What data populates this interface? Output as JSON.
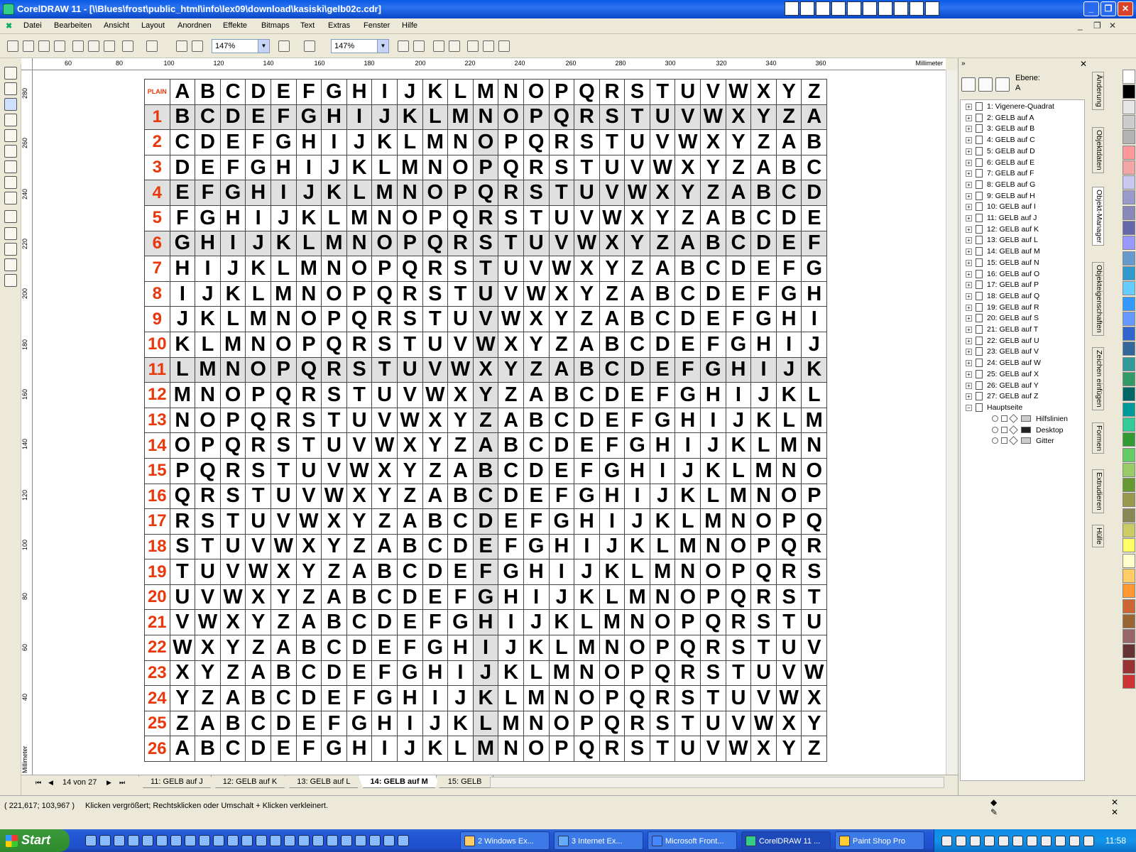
{
  "window": {
    "title": "CorelDRAW 11 - [\\\\Blues\\frost\\public_html\\info\\lex09\\download\\kasiski\\gelb02c.cdr]"
  },
  "menu": [
    "Datei",
    "Bearbeiten",
    "Ansicht",
    "Layout",
    "Anordnen",
    "Effekte",
    "Bitmaps",
    "Text",
    "Extras",
    "Fenster",
    "Hilfe"
  ],
  "toolbar": {
    "zoom1": "147%",
    "zoom2": "147%"
  },
  "ruler": {
    "unit": "Millimeter",
    "h_labels": [
      "60",
      "80",
      "100",
      "120",
      "140",
      "160",
      "180",
      "200",
      "220",
      "240",
      "260",
      "280",
      "300",
      "320",
      "340",
      "360"
    ],
    "v_labels": [
      "280",
      "260",
      "240",
      "220",
      "200",
      "180",
      "160",
      "140",
      "120",
      "100",
      "80",
      "60",
      "40"
    ]
  },
  "table": {
    "plain_label": "PLAIN",
    "alphabet": "ABCDEFGHIJKLMNOPQRSTUVWXYZ",
    "row_count": 26,
    "shaded_rows": [
      1,
      4,
      6,
      11
    ],
    "shaded_column": "M",
    "highlighted_rows": [
      1,
      4,
      6,
      11
    ]
  },
  "pagenav": {
    "counter": "14 von 27",
    "tabs": [
      "11: GELB auf J",
      "12: GELB auf K",
      "13: GELB auf L",
      "14: GELB auf M",
      "15: GELB"
    ],
    "active": "14: GELB auf M"
  },
  "docker": {
    "ebene_label": "Ebene:",
    "ebene_value": "A",
    "items": [
      "1: Vigenere-Quadrat",
      "2: GELB auf A",
      "3: GELB auf B",
      "4: GELB auf C",
      "5: GELB auf D",
      "6: GELB auf E",
      "7: GELB auf F",
      "8: GELB auf G",
      "9: GELB auf H",
      "10: GELB auf I",
      "11: GELB auf J",
      "12: GELB auf K",
      "13: GELB auf L",
      "14: GELB auf M",
      "15: GELB auf N",
      "16: GELB auf O",
      "17: GELB auf P",
      "18: GELB auf Q",
      "19: GELB auf R",
      "20: GELB auf S",
      "21: GELB auf T",
      "22: GELB auf U",
      "23: GELB auf V",
      "24: GELB auf W",
      "25: GELB auf X",
      "26: GELB auf Y",
      "27: GELB auf Z"
    ],
    "master": "Hauptseite",
    "master_layers": [
      "Hilfslinien",
      "Desktop",
      "Gitter"
    ],
    "side_tabs": [
      "Änderung",
      "Objektdaten",
      "Objekt-Manager",
      "Objekteigenschaften",
      "Zeichen einfügen",
      "Formen",
      "Extrudieren",
      "Hülle"
    ]
  },
  "palette": [
    "#ffffff",
    "#000000",
    "#e6e6e6",
    "#cccccc",
    "#b3b3b3",
    "#ff9999",
    "#f4a6a6",
    "#c8c8f0",
    "#9999cc",
    "#8888bb",
    "#6666aa",
    "#9999ff",
    "#6699cc",
    "#3399cc",
    "#66ccff",
    "#3399ff",
    "#6699ff",
    "#3366cc",
    "#336699",
    "#339999",
    "#339966",
    "#006666",
    "#009999",
    "#33cc99",
    "#339933",
    "#66cc66",
    "#99cc66",
    "#669933",
    "#99994d",
    "#888855",
    "#cccc66",
    "#ffff66",
    "#ffffcc",
    "#ffcc66",
    "#ff9933",
    "#cc6633",
    "#996633",
    "#996666",
    "#663333",
    "#993333",
    "#cc3333"
  ],
  "status": {
    "coords": "( 221,617; 103,967 )",
    "message": "Klicken vergrößert; Rechtsklicken oder Umschalt + Klicken verkleinert."
  },
  "taskbar": {
    "start": "Start",
    "tasks": [
      "2 Windows Ex...",
      "3 Internet Ex...",
      "Microsoft Front...",
      "CorelDRAW 11 ...",
      "Paint Shop Pro"
    ],
    "active": "CorelDRAW 11 ...",
    "clock": "11:58"
  }
}
